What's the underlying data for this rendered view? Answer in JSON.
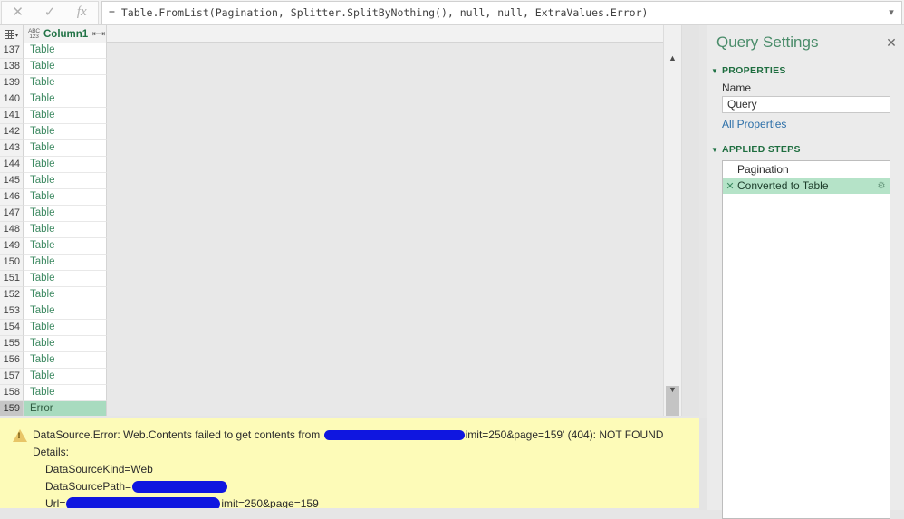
{
  "formula_bar": {
    "cancel_icon": "close-icon",
    "accept_icon": "check-icon",
    "fx_icon": "fx-icon",
    "formula": "= Table.FromList(Pagination, Splitter.SplitByNothing(), null, null, ExtraValues.Error)",
    "expand_icon": "chevron-down-icon"
  },
  "grid": {
    "corner_icon": "table-icon",
    "type_icon_top": "ABC",
    "type_icon_bottom": "123",
    "column_header": "Column1",
    "expand_columns_icon": "expand-columns-icon",
    "rows": [
      {
        "num": "137",
        "value": "Table",
        "selected": false
      },
      {
        "num": "138",
        "value": "Table",
        "selected": false
      },
      {
        "num": "139",
        "value": "Table",
        "selected": false
      },
      {
        "num": "140",
        "value": "Table",
        "selected": false
      },
      {
        "num": "141",
        "value": "Table",
        "selected": false
      },
      {
        "num": "142",
        "value": "Table",
        "selected": false
      },
      {
        "num": "143",
        "value": "Table",
        "selected": false
      },
      {
        "num": "144",
        "value": "Table",
        "selected": false
      },
      {
        "num": "145",
        "value": "Table",
        "selected": false
      },
      {
        "num": "146",
        "value": "Table",
        "selected": false
      },
      {
        "num": "147",
        "value": "Table",
        "selected": false
      },
      {
        "num": "148",
        "value": "Table",
        "selected": false
      },
      {
        "num": "149",
        "value": "Table",
        "selected": false
      },
      {
        "num": "150",
        "value": "Table",
        "selected": false
      },
      {
        "num": "151",
        "value": "Table",
        "selected": false
      },
      {
        "num": "152",
        "value": "Table",
        "selected": false
      },
      {
        "num": "153",
        "value": "Table",
        "selected": false
      },
      {
        "num": "154",
        "value": "Table",
        "selected": false
      },
      {
        "num": "155",
        "value": "Table",
        "selected": false
      },
      {
        "num": "156",
        "value": "Table",
        "selected": false
      },
      {
        "num": "157",
        "value": "Table",
        "selected": false
      },
      {
        "num": "158",
        "value": "Table",
        "selected": false
      },
      {
        "num": "159",
        "value": "Error",
        "selected": true
      }
    ],
    "scrollbar": {
      "up_arrow": "chevron-up-icon",
      "down_arrow": "chevron-down-icon"
    }
  },
  "error_panel": {
    "warning_icon": "warning-triangle-icon",
    "line1_prefix": "DataSource.Error: Web.Contents failed to get contents from",
    "line1_suffix": "imit=250&page=159' (404): NOT FOUND",
    "details_label": "Details:",
    "kind_line": "DataSourceKind=Web",
    "path_label": "DataSourcePath=",
    "url_label": "Url=",
    "url_suffix": "imit=250&page=159",
    "redaction_color": "#0f16e0"
  },
  "query_settings": {
    "title": "Query Settings",
    "close_icon": "close-icon",
    "properties_section": {
      "caret": "collapse-caret-icon",
      "label": "PROPERTIES",
      "name_label": "Name",
      "name_value": "Query",
      "all_properties_link": "All Properties"
    },
    "applied_steps_section": {
      "caret": "collapse-caret-icon",
      "label": "APPLIED STEPS",
      "steps": [
        {
          "name": "Pagination",
          "current": false,
          "has_delete": false,
          "has_gear": false
        },
        {
          "name": "Converted to Table",
          "current": true,
          "has_delete": true,
          "has_gear": true
        }
      ]
    }
  },
  "colors": {
    "accent_green": "#217346",
    "error_bg": "#fdfbb8",
    "selection_green": "#b5e3c8",
    "link_blue": "#2c6fa8"
  }
}
